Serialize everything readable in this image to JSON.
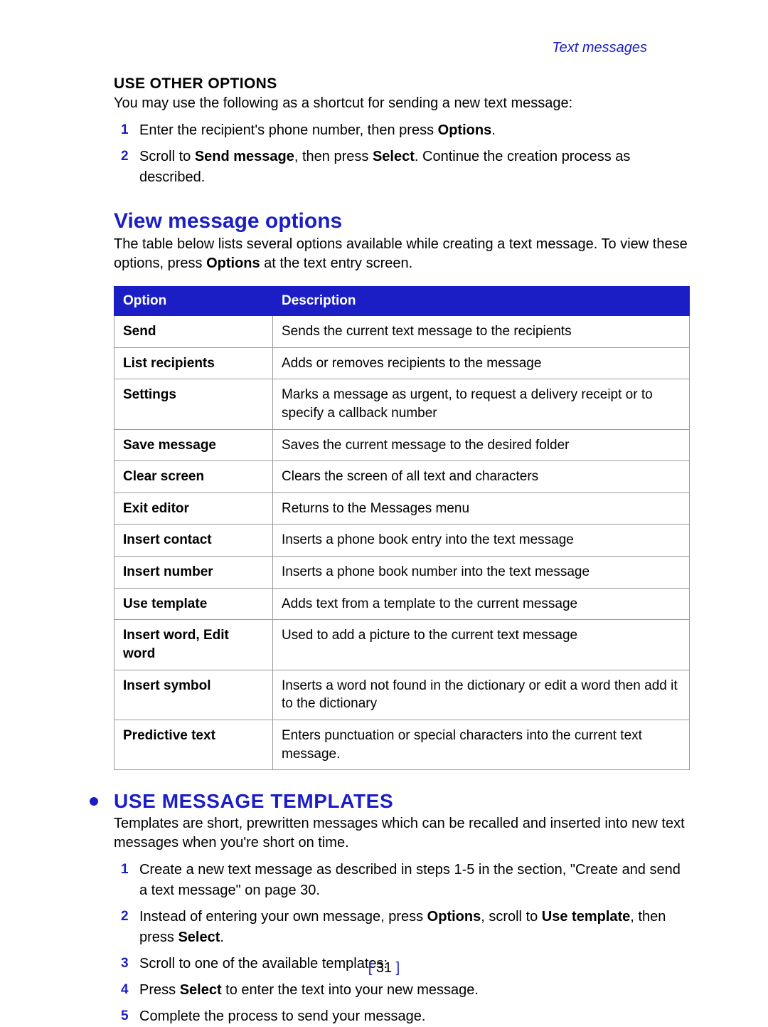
{
  "running_head": "Text messages",
  "page_number": "31",
  "section_a": {
    "title": "USE OTHER OPTIONS",
    "intro": "You may use the following as a shortcut for sending a new text message:",
    "steps": [
      {
        "n": "1",
        "pre": "Enter the recipient's phone number, then press ",
        "b1": "Options",
        "post": "."
      },
      {
        "n": "2",
        "pre": "Scroll to ",
        "b1": "Send message",
        "mid": ", then press ",
        "b2": "Select",
        "post": ". Continue the creation process as described."
      }
    ]
  },
  "section_b": {
    "title": "View message options",
    "intro_pre": "The table below lists several options available while creating a text message. To view these options, press ",
    "intro_b": "Options",
    "intro_post": " at the text entry screen.",
    "table": {
      "head_option": "Option",
      "head_desc": "Description",
      "rows": [
        {
          "opt": "Send",
          "desc": "Sends the current text message to the recipients"
        },
        {
          "opt": "List recipients",
          "desc": "Adds or removes recipients to the message"
        },
        {
          "opt": "Settings",
          "desc": "Marks a message as urgent, to request a delivery receipt or to specify a callback number"
        },
        {
          "opt": "Save message",
          "desc": "Saves the current message to the desired folder"
        },
        {
          "opt": "Clear screen",
          "desc": "Clears the screen of all text and characters"
        },
        {
          "opt": "Exit editor",
          "desc": "Returns to the Messages menu"
        },
        {
          "opt": "Insert contact",
          "desc": "Inserts a phone book entry into the text message"
        },
        {
          "opt": "Insert number",
          "desc": "Inserts a phone book number into the text message"
        },
        {
          "opt": "Use template",
          "desc": "Adds text from a template to the current message"
        },
        {
          "opt": "Insert word, Edit word",
          "desc": "Used to add a picture to the current text message"
        },
        {
          "opt": "Insert symbol",
          "desc": "Inserts a word not found in the dictionary or edit a word then add it to the dictionary"
        },
        {
          "opt": "Predictive text",
          "desc": "Enters punctuation or special characters into the current text message."
        }
      ]
    }
  },
  "section_c": {
    "title": "USE MESSAGE TEMPLATES",
    "intro": "Templates are short, prewritten messages which can be recalled and inserted into new text messages when you're short on time.",
    "steps": [
      {
        "n": "1",
        "text": "Create a new text message as described in steps 1-5 in the section, \"Create and send a text message\" on page 30."
      },
      {
        "n": "2",
        "pre": "Instead of entering your own message, press ",
        "b1": "Options",
        "mid": ", scroll to ",
        "b2": "Use template",
        "mid2": ", then press ",
        "b3": "Select",
        "post": "."
      },
      {
        "n": "3",
        "text": "Scroll to one of the available templates:"
      },
      {
        "n": "4",
        "pre": "Press ",
        "b1": "Select",
        "post": " to enter the text into your new message."
      },
      {
        "n": "5",
        "text": "Complete the process to send your message."
      }
    ]
  }
}
